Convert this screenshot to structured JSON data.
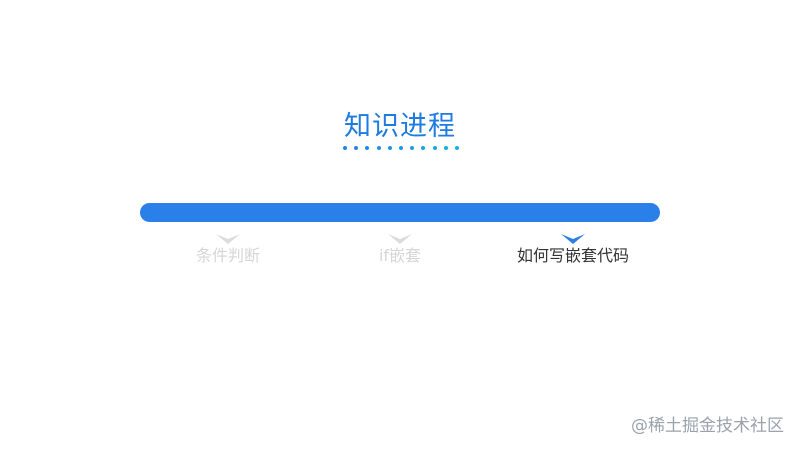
{
  "title": "知识进程",
  "colors": {
    "accent": "#2a80e8",
    "title": "#1e7be0",
    "dot_start": "#2a7fe6",
    "dot_end": "#16b1e0",
    "inactive_text": "#d6d6d6",
    "active_text": "#333333",
    "inactive_marker": "#dcdcdc",
    "active_marker": "#2a80e8"
  },
  "steps": [
    {
      "label": "条件判断",
      "state": "inactive"
    },
    {
      "label": "if嵌套",
      "state": "inactive"
    },
    {
      "label": "如何写嵌套代码",
      "state": "active"
    }
  ],
  "watermark": "@稀土掘金技术社区"
}
